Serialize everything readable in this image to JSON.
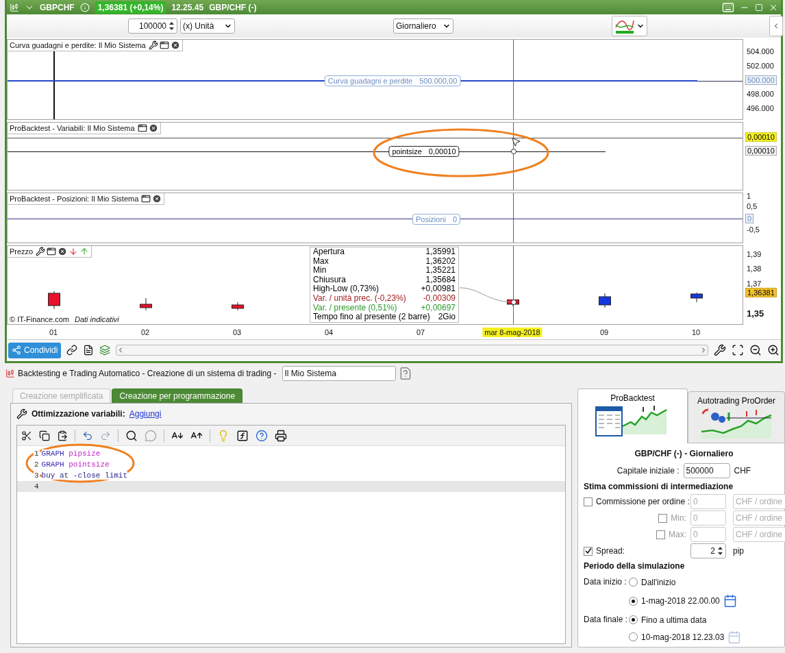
{
  "title_bar": {
    "symbol": "GBPCHF",
    "price": "1,36381 (+0,14%)",
    "time": "12.25.45",
    "instrument": "GBP/CHF (-)"
  },
  "toolbar": {
    "quantity": "100000",
    "unit": "(x) Unità",
    "timeframe": "Giornaliero"
  },
  "panels": [
    {
      "kind": "equity",
      "title": "Curva guadagni e perdite: Il Mio Sistema",
      "line_label": "Curva guadagni e perdite",
      "line_value": "500.000,00",
      "yticks": [
        {
          "text": "504.000"
        },
        {
          "text": "502.000"
        },
        {
          "text": "498.000"
        },
        {
          "text": "496.000"
        }
      ],
      "markers": [
        {
          "text": "500.000",
          "kind": "series"
        }
      ]
    },
    {
      "kind": "variables",
      "title": "ProBacktest - Variabili: Il Mio Sistema",
      "line_label": "pointsize",
      "line_value": "0,00010",
      "markers": [
        {
          "text": "0,00010",
          "kind": "cursor"
        },
        {
          "text": "0,00010",
          "kind": "plain"
        }
      ]
    },
    {
      "kind": "positions",
      "title": "ProBacktest - Posizioni: Il Mio Sistema",
      "line_label": "Posizioni",
      "line_value": "0",
      "yticks": [
        {
          "text": "1"
        },
        {
          "text": "0,5"
        },
        {
          "text": "-0,5"
        }
      ],
      "markers": [
        {
          "text": "0",
          "kind": "series"
        }
      ]
    },
    {
      "kind": "price",
      "title": "Prezzo",
      "yticks": [
        {
          "text": "1,39",
          "major": false
        },
        {
          "text": "1,38",
          "major": false
        },
        {
          "text": "1,37",
          "major": false
        },
        {
          "text": "1,35",
          "major": true
        }
      ],
      "markers": [
        {
          "text": "1,36381",
          "kind": "last"
        }
      ],
      "copyright": "© IT-Finance.com",
      "note": "Dati indicativi",
      "candles": [
        {
          "color": "#e8102a"
        },
        {
          "color": "#e8102a"
        },
        {
          "color": "#e8102a"
        },
        {
          "color": "#e8102a"
        },
        {
          "color": "#1438e0"
        },
        {
          "color": "#1438e0"
        }
      ],
      "info": [
        {
          "label": "Apertura",
          "value": "1,35991",
          "color": "#000000"
        },
        {
          "label": "Max",
          "value": "1,36202",
          "color": "#000000"
        },
        {
          "label": "Min",
          "value": "1,35221",
          "color": "#000000"
        },
        {
          "label": "Chiusura",
          "value": "1,35684",
          "color": "#000000"
        },
        {
          "label": "High-Low (0,73%)",
          "value": "+0,00981",
          "color": "#000000"
        },
        {
          "label": "Var. / unità prec. (-0,23%)",
          "value": "-0,00309",
          "color": "#a11d1d"
        },
        {
          "label": "Var. / presente (0,51%)",
          "value": "+0,00697",
          "color": "#2a9a2a"
        },
        {
          "label": "Tempo fino al presente (2 barre)",
          "value": "2Gio",
          "color": "#000000"
        }
      ]
    }
  ],
  "x_axis": [
    {
      "text": "01",
      "selected": false
    },
    {
      "text": "02",
      "selected": false
    },
    {
      "text": "03",
      "selected": false
    },
    {
      "text": "04",
      "selected": false
    },
    {
      "text": "07",
      "selected": false
    },
    {
      "text": "mar 8-mag-2018",
      "selected": true
    },
    {
      "text": "09",
      "selected": false
    },
    {
      "text": "10",
      "selected": false
    }
  ],
  "share_button": "Condividi",
  "builder": {
    "title": "Backtesting e Trading Automatico - Creazione di un sistema di trading  -",
    "system_name": "Il Mio Sistema",
    "tabs": [
      {
        "label": "Creazione semplificata",
        "selected": false
      },
      {
        "label": "Creazione per programmazione",
        "selected": true
      }
    ],
    "optimization_label": "Ottimizzazione variabili:",
    "optimization_link": "Aggiungi",
    "code": [
      {
        "number": "1",
        "current": false,
        "tokens": [
          {
            "text": "GRAPH",
            "kind": "keyword"
          },
          {
            "text": "pipsize",
            "kind": "variable"
          }
        ]
      },
      {
        "number": "2",
        "current": false,
        "tokens": [
          {
            "text": "GRAPH",
            "kind": "keyword"
          },
          {
            "text": "pointsize",
            "kind": "variable"
          }
        ]
      },
      {
        "number": "3",
        "current": false,
        "tokens": [
          {
            "text": "buy at -close limit",
            "kind": "instruction"
          }
        ]
      },
      {
        "number": "4",
        "current": true
      }
    ]
  },
  "settings": {
    "tabs": [
      {
        "label": "ProBacktest",
        "selected": true,
        "kind": "backtest"
      },
      {
        "label": "Autotrading ProOrder",
        "selected": false,
        "kind": "autotrading"
      }
    ],
    "subtitle": "GBP/CHF (-) - Giornaliero",
    "capital_label": "Capitale iniziale :",
    "capital": "500000",
    "currency": "CHF",
    "commissions_heading": "Stima commissioni di intermediazione",
    "commissions": [
      {
        "label": "Commissione per ordine :",
        "checked": false,
        "value": "0",
        "unit": "CHF / ordine",
        "kind": "main"
      },
      {
        "label": "Min:",
        "checked": false,
        "value": "0",
        "unit": "CHF / ordine",
        "kind": "sub"
      },
      {
        "label": "Max:",
        "checked": false,
        "value": "0",
        "unit": "CHF / ordine",
        "kind": "sub"
      }
    ],
    "spread": {
      "label": "Spread:",
      "checked": true,
      "value": "2",
      "unit": "pip"
    },
    "period_heading": "Periodo della simulazione",
    "periods": [
      {
        "label": "Data inizio :",
        "options": [
          {
            "label": "Dall'inizio",
            "selected": false,
            "calendar": false
          },
          {
            "label": "1-mag-2018 22.00.00",
            "selected": true,
            "calendar": true
          }
        ]
      },
      {
        "label": "Data finale :",
        "options": [
          {
            "label": "Fino a ultima data",
            "selected": true,
            "calendar": false
          },
          {
            "label": "10-mag-2018 12.23.03",
            "selected": false,
            "calendar": true
          }
        ]
      }
    ]
  }
}
